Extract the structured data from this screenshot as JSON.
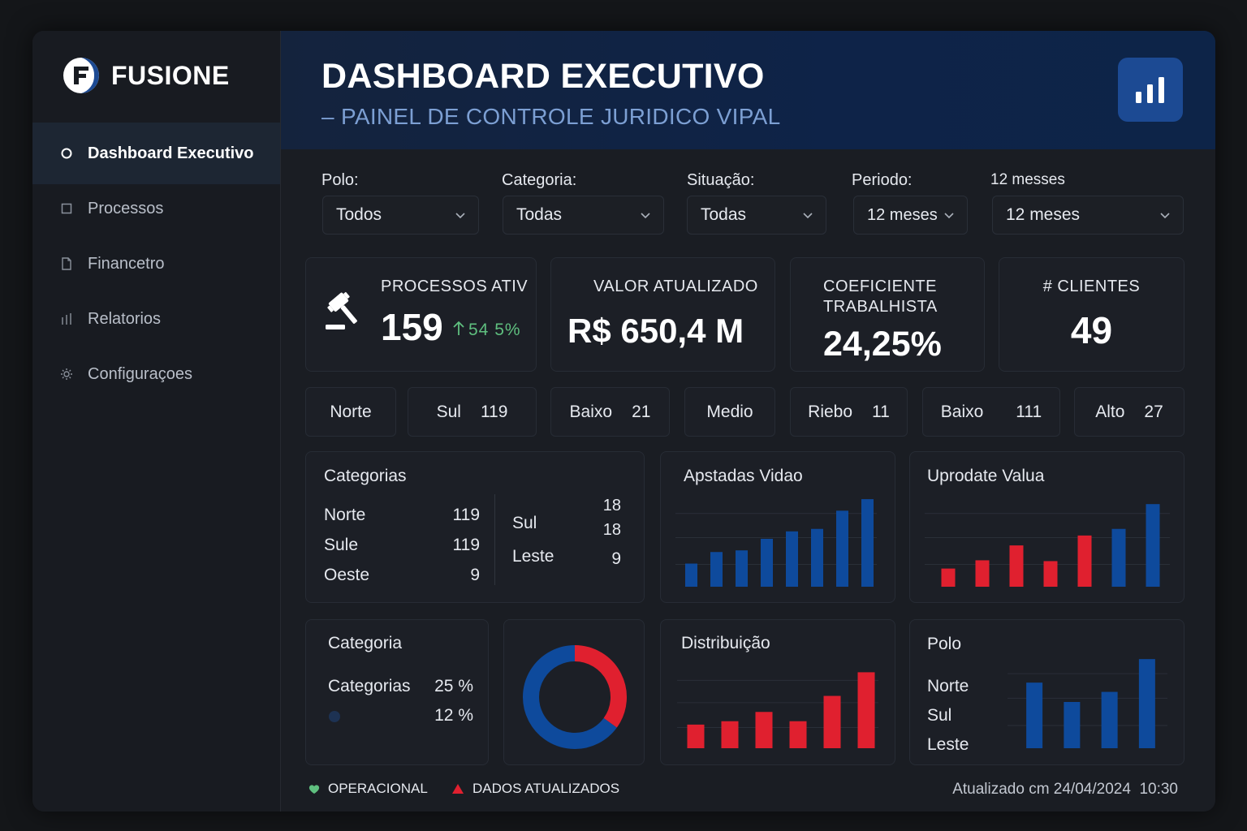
{
  "app": {
    "name": "FUSIONE"
  },
  "sidebar": {
    "items": [
      {
        "label": "Dashboard Executivo",
        "icon": "circle-icon",
        "active": true
      },
      {
        "label": "Processos",
        "icon": "square-icon",
        "active": false
      },
      {
        "label": "Financetro",
        "icon": "document-icon",
        "active": false
      },
      {
        "label": "Relatorios",
        "icon": "bars-icon",
        "active": false
      },
      {
        "label": "Configuraçoes",
        "icon": "gear-icon",
        "active": false
      }
    ]
  },
  "header": {
    "title": "DASHBOARD EXECUTIVO",
    "subtitle": "– PAINEL DE CONTROLE JURIDICO VIPAL",
    "action_icon": "bar-chart-icon"
  },
  "filters": {
    "polo": {
      "label": "Polo:",
      "value": "Todos"
    },
    "categoria": {
      "label": "Categoria:",
      "value": "Todas"
    },
    "situacao": {
      "label": "Situação:",
      "value": "Todas"
    },
    "periodo": {
      "label": "Periodo:",
      "value": "12 meses"
    },
    "extra": {
      "label": "12 messes",
      "value": "12 meses"
    }
  },
  "kpis": {
    "processos": {
      "label": "PROCESSOS ATIV",
      "value": "159",
      "delta": "54 5%",
      "icon": "gavel-icon"
    },
    "valor": {
      "label": "VALOR ATUALIZADO",
      "value": "R$ 650,4 M"
    },
    "coeficiente": {
      "label_line1": "COEFICIENTE",
      "label_line2": "TRABALHISTA",
      "value": "24,25%"
    },
    "clientes": {
      "label": "# CLIENTES",
      "value": "49"
    }
  },
  "pills": [
    {
      "label": "Norte",
      "value": ""
    },
    {
      "label": "Sul",
      "value": "119"
    },
    {
      "label": "Baixo",
      "value": "21"
    },
    {
      "label": "Medio",
      "value": ""
    },
    {
      "label": "Riebo",
      "value": "11"
    },
    {
      "label": "Baixo",
      "value": "111"
    },
    {
      "label": "Alto",
      "value": "27"
    }
  ],
  "categorias_card": {
    "title": "Categorias",
    "left": [
      {
        "label": "Norte",
        "value": "119"
      },
      {
        "label": "Sule",
        "value": "119"
      },
      {
        "label": "Oeste",
        "value": "9"
      }
    ],
    "right": [
      {
        "label": "",
        "value": "18"
      },
      {
        "label": "Sul",
        "value": "18"
      },
      {
        "label": "Leste",
        "value": "9"
      }
    ]
  },
  "categoria_card": {
    "title": "Categoria",
    "rows": [
      {
        "label": "Categorias",
        "value": "25 %"
      },
      {
        "label": "",
        "value": "12 %"
      }
    ]
  },
  "polo_card": {
    "title": "Polo",
    "labels": [
      "Norte",
      "Sul",
      "Leste"
    ]
  },
  "footer": {
    "status1": "OPERACIONAL",
    "status2": "DADOS ATUALIZADOS",
    "updated": "Atualizado cm 24/04/2024  10:30"
  },
  "colors": {
    "blue": "#0e4a9c",
    "red": "#e0202f",
    "green": "#5fbf7f",
    "accent": "#1c4a93"
  },
  "chart_data": [
    {
      "type": "bar",
      "title": "Apstadas Vidao",
      "series": [
        {
          "values": [
            28,
            42,
            44,
            58,
            67,
            70,
            92,
            106
          ],
          "color": "#0e4a9c"
        }
      ],
      "ylim": [
        0,
        110
      ]
    },
    {
      "type": "bar",
      "title": "Uprodate Valua",
      "series": [
        {
          "values": [
            22,
            32,
            50,
            31,
            62,
            70,
            100
          ],
          "colors": [
            "#e0202f",
            "#e0202f",
            "#e0202f",
            "#e0202f",
            "#e0202f",
            "#0e4a9c",
            "#0e4a9c"
          ]
        }
      ],
      "ylim": [
        0,
        110
      ]
    },
    {
      "type": "bar",
      "title": "Distribuição",
      "series": [
        {
          "values": [
            28,
            32,
            43,
            32,
            62,
            90
          ],
          "color": "#e0202f"
        }
      ],
      "ylim": [
        0,
        100
      ]
    },
    {
      "type": "bar",
      "title": "Polo",
      "series": [
        {
          "values": [
            78,
            55,
            67,
            106
          ],
          "color": "#0e4a9c"
        }
      ],
      "ylim": [
        0,
        110
      ]
    },
    {
      "type": "pie",
      "title": "",
      "slices": [
        {
          "value": 65,
          "color": "#0e4a9c"
        },
        {
          "value": 35,
          "color": "#e0202f"
        }
      ]
    }
  ]
}
